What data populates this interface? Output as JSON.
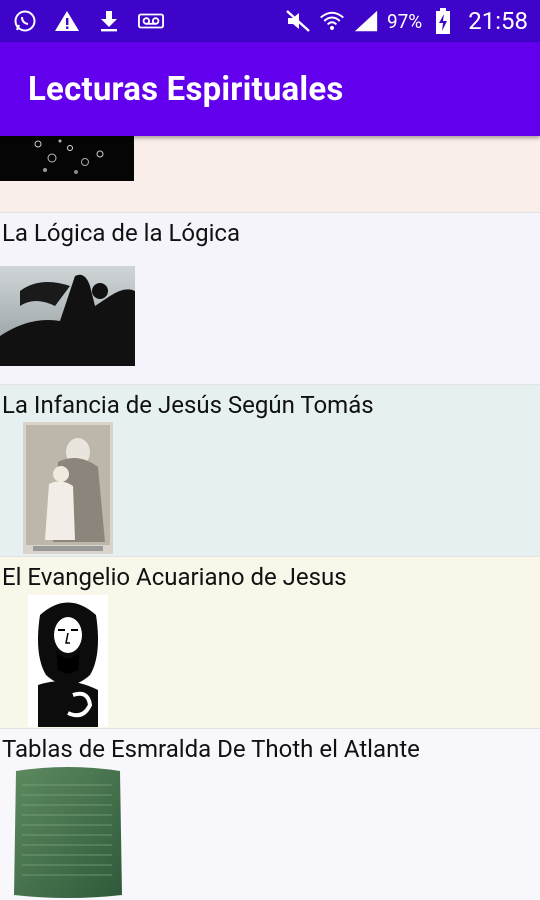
{
  "status_bar": {
    "battery_percent": "97%",
    "time": "21:58",
    "icons_left": [
      "whatsapp-icon",
      "warning-icon",
      "download-icon",
      "voicemail-icon"
    ],
    "icons_right": [
      "mute-icon",
      "wifi-icon",
      "signal-icon",
      "battery-charging-icon"
    ]
  },
  "app_bar": {
    "title": "Lecturas Espirituales"
  },
  "list": {
    "items": [
      {
        "title": "",
        "bg": "#f9eeea",
        "thumb": "bubbles-image"
      },
      {
        "title": "La Lógica de la Lógica",
        "bg": "#f6f4fb",
        "thumb": "silhouette-image"
      },
      {
        "title": "La Infancia de Jesús Según Tomás",
        "bg": "#e7f0f0",
        "thumb": "mother-child-engraving"
      },
      {
        "title": "El Evangelio Acuariano de Jesus",
        "bg": "#f8f7ea",
        "thumb": "jesus-portrait"
      },
      {
        "title": "Tablas de Esmralda De Thoth el Atlante",
        "bg": "#f8f7fc",
        "thumb": "emerald-tablet"
      }
    ]
  }
}
